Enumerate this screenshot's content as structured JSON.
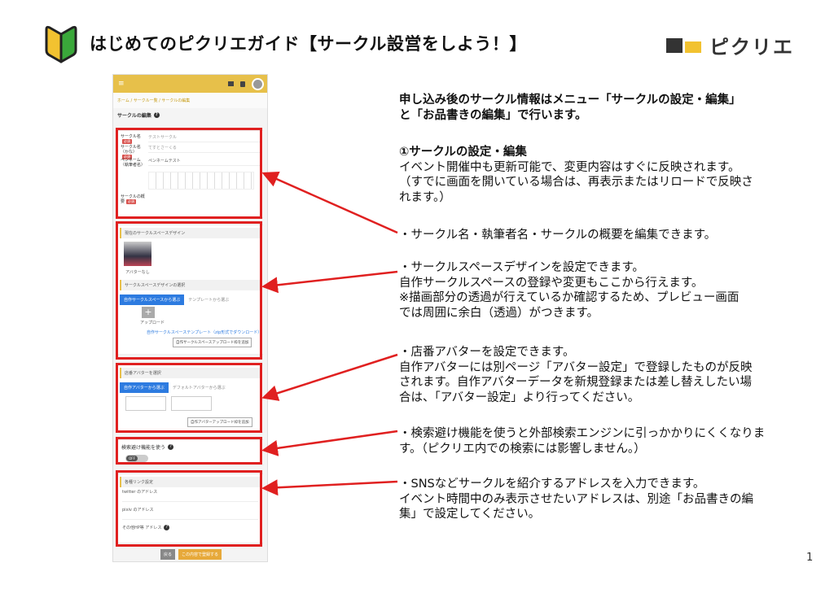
{
  "header": {
    "title": "はじめてのピクリエガイド【サークル設営をしよう！】",
    "brand": "ピクリエ",
    "brand_colors": [
      "#333333",
      "#f2c230"
    ]
  },
  "colors": {
    "accent_red": "#e02020",
    "leaf_yellow": "#f2c230",
    "leaf_green": "#3aa83a",
    "app_yellow": "#e7c04a",
    "app_blue": "#2d7be0"
  },
  "screenshot": {
    "menu_icon": "≡",
    "breadcrumb": "ホーム / サークル一覧 / サークルの編集",
    "page_heading": "サークルの編集",
    "required": "必須",
    "fields": [
      {
        "label": "サークル名",
        "value": "テストサークル"
      },
      {
        "label": "サークル名（かな）",
        "value": "てすとさーくる"
      },
      {
        "label": "ペンネーム（執筆者名）",
        "value": "ペンネームテスト"
      },
      {
        "label": "サークルの概要",
        "value": ""
      }
    ],
    "space_heading": "現在のサークルスペースデザイン",
    "space_caption": "アバターなし",
    "space_select_heading": "サークルスペースデザインの選択",
    "space_tab_own": "自作サークルスペースから選ぶ",
    "space_tab_template": "テンプレートから選ぶ",
    "add_label": "アップロード",
    "space_template_link": "自作サークルスペーステンプレート（zip形式でダウンロード）",
    "space_upload_btn": "自作サークルスペースアップロード枠を追加",
    "avatar_heading": "店番アバターを選択",
    "avatar_tab_own": "自作アバターから選ぶ",
    "avatar_tab_default": "デフォルトアバターから選ぶ",
    "avatar_upload_btn": "自作アバターアップロード枠を追加",
    "search_heading": "検索避け機能を使う",
    "toggle_label": "OFF",
    "links_heading": "各種リンク設定",
    "link_twitter": "twitter のアドレス",
    "link_pixiv": "pixiv のアドレス",
    "link_other": "その他HP等 アドレス",
    "back_btn": "戻る",
    "save_btn": "この内容で登録する"
  },
  "descriptions": {
    "intro_1": "申し込み後のサークル情報はメニュー「サークルの設定・編集」",
    "intro_2": "と「お品書きの編集」で行います。",
    "sec_title": "①サークルの設定・編集",
    "sec_1": "イベント開催中も更新可能で、変更内容はすぐに反映されます。",
    "sec_2": "（すでに画面を開いている場合は、再表示またはリロードで反映さ",
    "sec_3": "れます。）",
    "p1": "・サークル名・執筆者名・サークルの概要を編集できます。",
    "p2_1": "・サークルスペースデザインを設定できます。",
    "p2_2": "自作サークルスペースの登録や変更もここから行えます。",
    "p2_3": "※描画部分の透過が行えているか確認するため、プレビュー画面",
    "p2_4": "では周囲に余白（透過）がつきます。",
    "p3_1": "・店番アバターを設定できます。",
    "p3_2": "自作アバターには別ページ「アバター設定」で登録したものが反映",
    "p3_3": "されます。自作アバターデータを新規登録または差し替えしたい場",
    "p3_4": "合は、「アバター設定」より行ってください。",
    "p4_1": "・検索避け機能を使うと外部検索エンジンに引っかかりにくくなりま",
    "p4_2": "す。（ピクリエ内での検索には影響しません。）",
    "p5_1": "・SNSなどサークルを紹介するアドレスを入力できます。",
    "p5_2": "イベント時間中のみ表示させたいアドレスは、別途「お品書きの編",
    "p5_3": "集」で設定してください。"
  },
  "page_number": "1"
}
